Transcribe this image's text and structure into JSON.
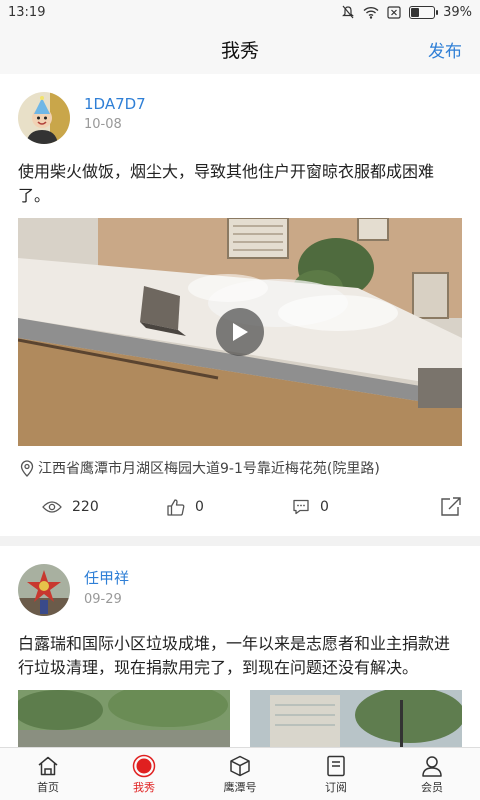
{
  "status": {
    "time": "13:19",
    "battery": "39%",
    "battery_level": 0.39
  },
  "nav": {
    "title": "我秀",
    "publish": "发布"
  },
  "posts": [
    {
      "username": "1DA7D7",
      "date": "10-08",
      "text": "使用柴火做饭，烟尘大，导致其他住户开窗晾衣服都成困难了。",
      "location": "江西省鹰潭市月湖区梅园大道9-1号靠近梅花苑(院里路)",
      "views": "220",
      "likes": "0",
      "comments": "0"
    },
    {
      "username": "任甲祥",
      "date": "09-29",
      "text": "白露瑞和国际小区垃圾成堆，一年以来是志愿者和业主捐款进行垃圾清理，现在捐款用完了，到现在问题还没有解决。"
    }
  ],
  "tabs": [
    {
      "label": "首页",
      "icon": "home-icon"
    },
    {
      "label": "我秀",
      "icon": "record-icon"
    },
    {
      "label": "鹰潭号",
      "icon": "cube-icon"
    },
    {
      "label": "订阅",
      "icon": "document-icon"
    },
    {
      "label": "会员",
      "icon": "user-icon"
    }
  ],
  "colors": {
    "accent": "#2f7fd6",
    "active_tab": "#e02020"
  }
}
